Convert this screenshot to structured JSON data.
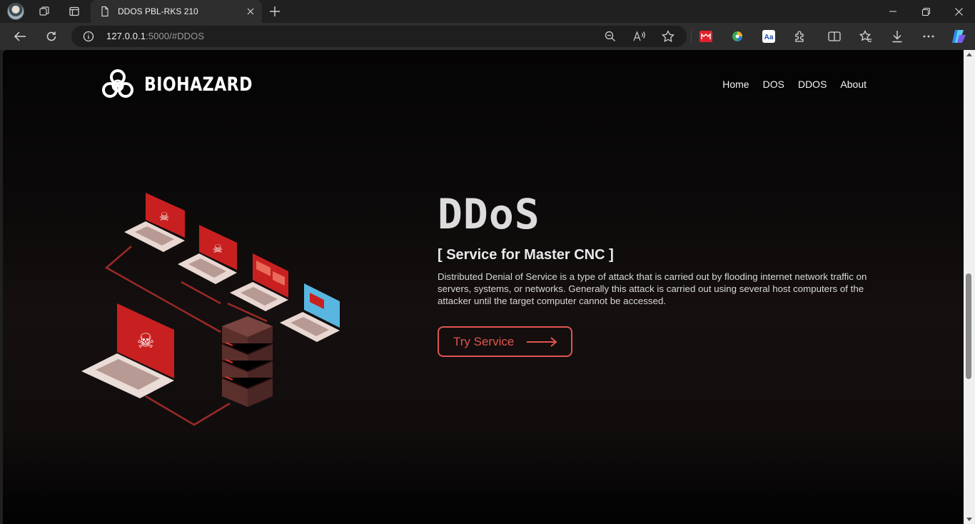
{
  "browser": {
    "tab_title": "DDOS PBL-RKS 210",
    "url_host": "127.0.0.1",
    "url_rest": ":5000/#DDOS"
  },
  "site": {
    "brand": "BIOHAZARD",
    "nav": [
      "Home",
      "DOS",
      "DDOS",
      "About"
    ]
  },
  "hero": {
    "title": "DDoS",
    "subtitle": "[ Service for Master CNC ]",
    "description": "Distributed Denial of Service is a type of attack that is carried out by flooding internet network traffic on servers, systems, or networks. Generally this attack is carried out using several host computers of the attacker until the target computer cannot be accessed.",
    "cta": "Try Service"
  },
  "colors": {
    "accent": "#e0554f",
    "page_bg": "#0b0909",
    "chrome_bg": "#202020"
  },
  "icons": [
    "profile-avatar",
    "workspaces-icon",
    "tab-actions-icon",
    "page-icon",
    "close-icon",
    "plus-icon",
    "minimize-icon",
    "restore-icon",
    "back-icon",
    "refresh-icon",
    "info-icon",
    "zoom-out-icon",
    "read-aloud-icon",
    "favorite-star-icon",
    "extension-icons",
    "split-screen-icon",
    "favorites-icon",
    "download-icon",
    "more-icon",
    "copilot-icon",
    "biohazard-icon",
    "arrow-right-icon"
  ]
}
